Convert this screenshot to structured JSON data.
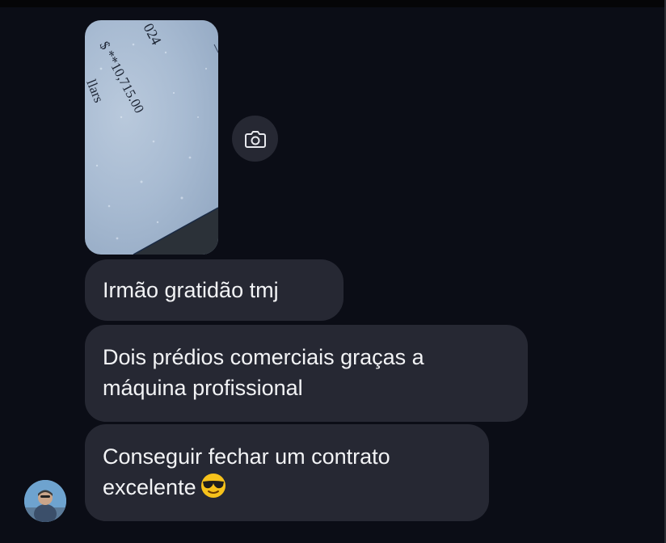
{
  "chat": {
    "photo": {
      "text_top": "024",
      "text_mid": "$ **10,715.00",
      "text_side": "llars"
    },
    "camera_button": {
      "icon": "camera-icon"
    },
    "messages": [
      {
        "text_lines": [
          "Irmão gratidão tmj"
        ]
      },
      {
        "text_lines": [
          "Dois prédios comerciais graças a",
          "máquina profissional"
        ]
      },
      {
        "text_lines": [
          "Conseguir fechar um contrato",
          "excelente"
        ],
        "emoji": "sunglasses-face"
      }
    ],
    "sender_avatar": {
      "icon": "avatar"
    }
  },
  "colors": {
    "background": "#0b0d16",
    "bubble": "#262833",
    "text": "#f2f3f5"
  }
}
